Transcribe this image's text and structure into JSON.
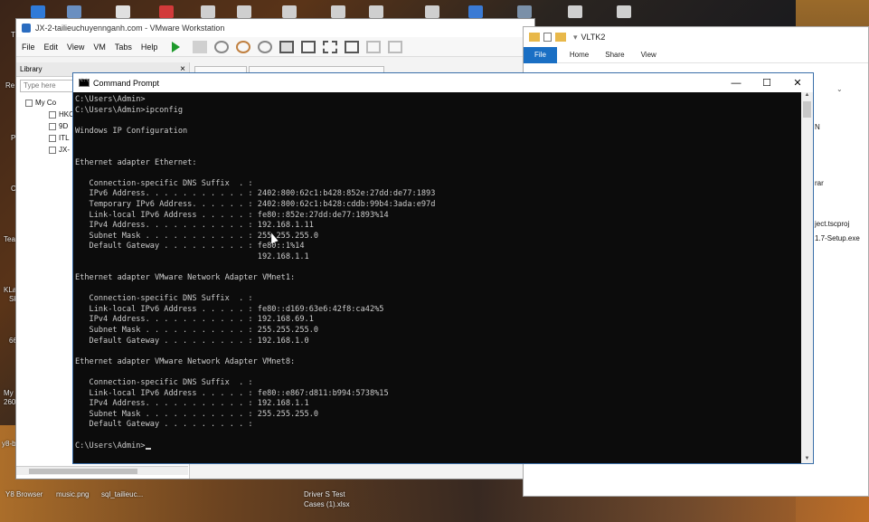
{
  "desktop": {
    "left_labels": [
      "Re",
      "T",
      "P",
      "C",
      "Tea",
      "KLa",
      "Sk",
      "66",
      "My",
      "260",
      "y8-b"
    ],
    "bottom_icons": [
      "Y8 Browser",
      "music.png",
      "sql_tailieuc...",
      "Driver S Test",
      "Cases (1).xlsx"
    ]
  },
  "vmware": {
    "title": "JX-2-tailieuchuyennganh.com - VMware Workstation",
    "menu": [
      "File",
      "Edit",
      "View",
      "VM",
      "Tabs",
      "Help"
    ],
    "library": {
      "heading": "Library",
      "close": "×",
      "search_placeholder": "Type here",
      "root": "My Co",
      "items": [
        "HKC",
        "9D",
        "ITL",
        "JX-"
      ]
    }
  },
  "explorer": {
    "title": "VLTK2",
    "tabs": [
      "File",
      "Home",
      "Share",
      "View"
    ],
    "visible_text": [
      "N",
      "rar",
      "ject.tscproj",
      "1.7-Setup.exe"
    ]
  },
  "cmd": {
    "title": "Command Prompt",
    "controls": {
      "minimize": "—",
      "maximize": "☐",
      "close": "✕"
    },
    "lines": [
      "C:\\Users\\Admin>",
      "C:\\Users\\Admin>ipconfig",
      "",
      "Windows IP Configuration",
      "",
      "",
      "Ethernet adapter Ethernet:",
      "",
      "   Connection-specific DNS Suffix  . :",
      "   IPv6 Address. . . . . . . . . . . : 2402:800:62c1:b428:852e:27dd:de77:1893",
      "   Temporary IPv6 Address. . . . . . : 2402:800:62c1:b428:cddb:99b4:3ada:e97d",
      "   Link-local IPv6 Address . . . . . : fe80::852e:27dd:de77:1893%14",
      "   IPv4 Address. . . . . . . . . . . : 192.168.1.11",
      "   Subnet Mask . . . . . . . . . . . : 255.255.255.0",
      "   Default Gateway . . . . . . . . . : fe80::1%14",
      "                                       192.168.1.1",
      "",
      "Ethernet adapter VMware Network Adapter VMnet1:",
      "",
      "   Connection-specific DNS Suffix  . :",
      "   Link-local IPv6 Address . . . . . : fe80::d169:63e6:42f8:ca42%5",
      "   IPv4 Address. . . . . . . . . . . : 192.168.69.1",
      "   Subnet Mask . . . . . . . . . . . : 255.255.255.0",
      "   Default Gateway . . . . . . . . . : 192.168.1.0",
      "",
      "Ethernet adapter VMware Network Adapter VMnet8:",
      "",
      "   Connection-specific DNS Suffix  . :",
      "   Link-local IPv6 Address . . . . . : fe80::e867:d811:b994:5738%15",
      "   IPv4 Address. . . . . . . . . . . : 192.168.1.1",
      "   Subnet Mask . . . . . . . . . . . : 255.255.255.0",
      "   Default Gateway . . . . . . . . . :",
      "",
      "C:\\Users\\Admin>"
    ]
  }
}
